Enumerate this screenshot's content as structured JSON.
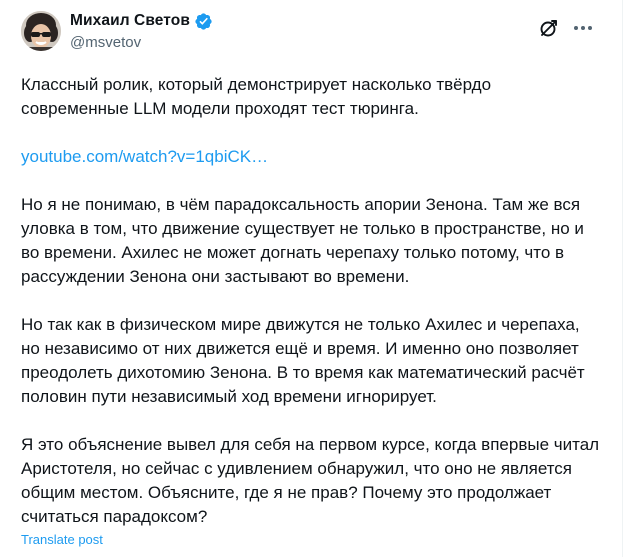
{
  "author": {
    "display_name": "Михаил Светов",
    "handle": "@msvetov",
    "verified_icon": "verified-badge-icon",
    "avatar_icon": "avatar"
  },
  "header_actions": {
    "grok_icon": "grok-icon",
    "more_icon": "more-dots-icon"
  },
  "tweet": {
    "paragraph_1": "Классный ролик, который демонстрирует насколько твёрдо\nсовременные LLM модели проходят тест тюринга.",
    "link_text": "youtube.com/watch?v=1qbiCK…",
    "paragraph_2": "Но я не понимаю, в чём парадоксальность апории Зенона. Там же вся\nуловка в том, что движение существует не только в пространстве, но и\nво времени. Ахилес не может догнать черепаху только потому, что в\nрассуждении Зенона они застывают во времени.",
    "paragraph_3": "Но так как в физическом мире движутся не только Ахилес и черепаха,\nно независимо от них движется ещё и время. И именно оно позволяет\nпреодолеть дихотомию Зенона. В то время как математический расчёт\nполовин пути независимый ход времени игнорирует.",
    "paragraph_4": "Я это объяснение вывел для себя на первом курсе, когда впервые читал\nАристотеля, но сейчас с удивлением обнаружил, что оно не является\nобщим местом. Объясните, где я не прав? Почему это продолжает\nсчитаться парадоксом?",
    "translate_label": "Translate post"
  },
  "colors": {
    "text_primary": "#0f1419",
    "text_secondary": "#536471",
    "link": "#1d9bf0",
    "verified": "#1d9bf0"
  }
}
